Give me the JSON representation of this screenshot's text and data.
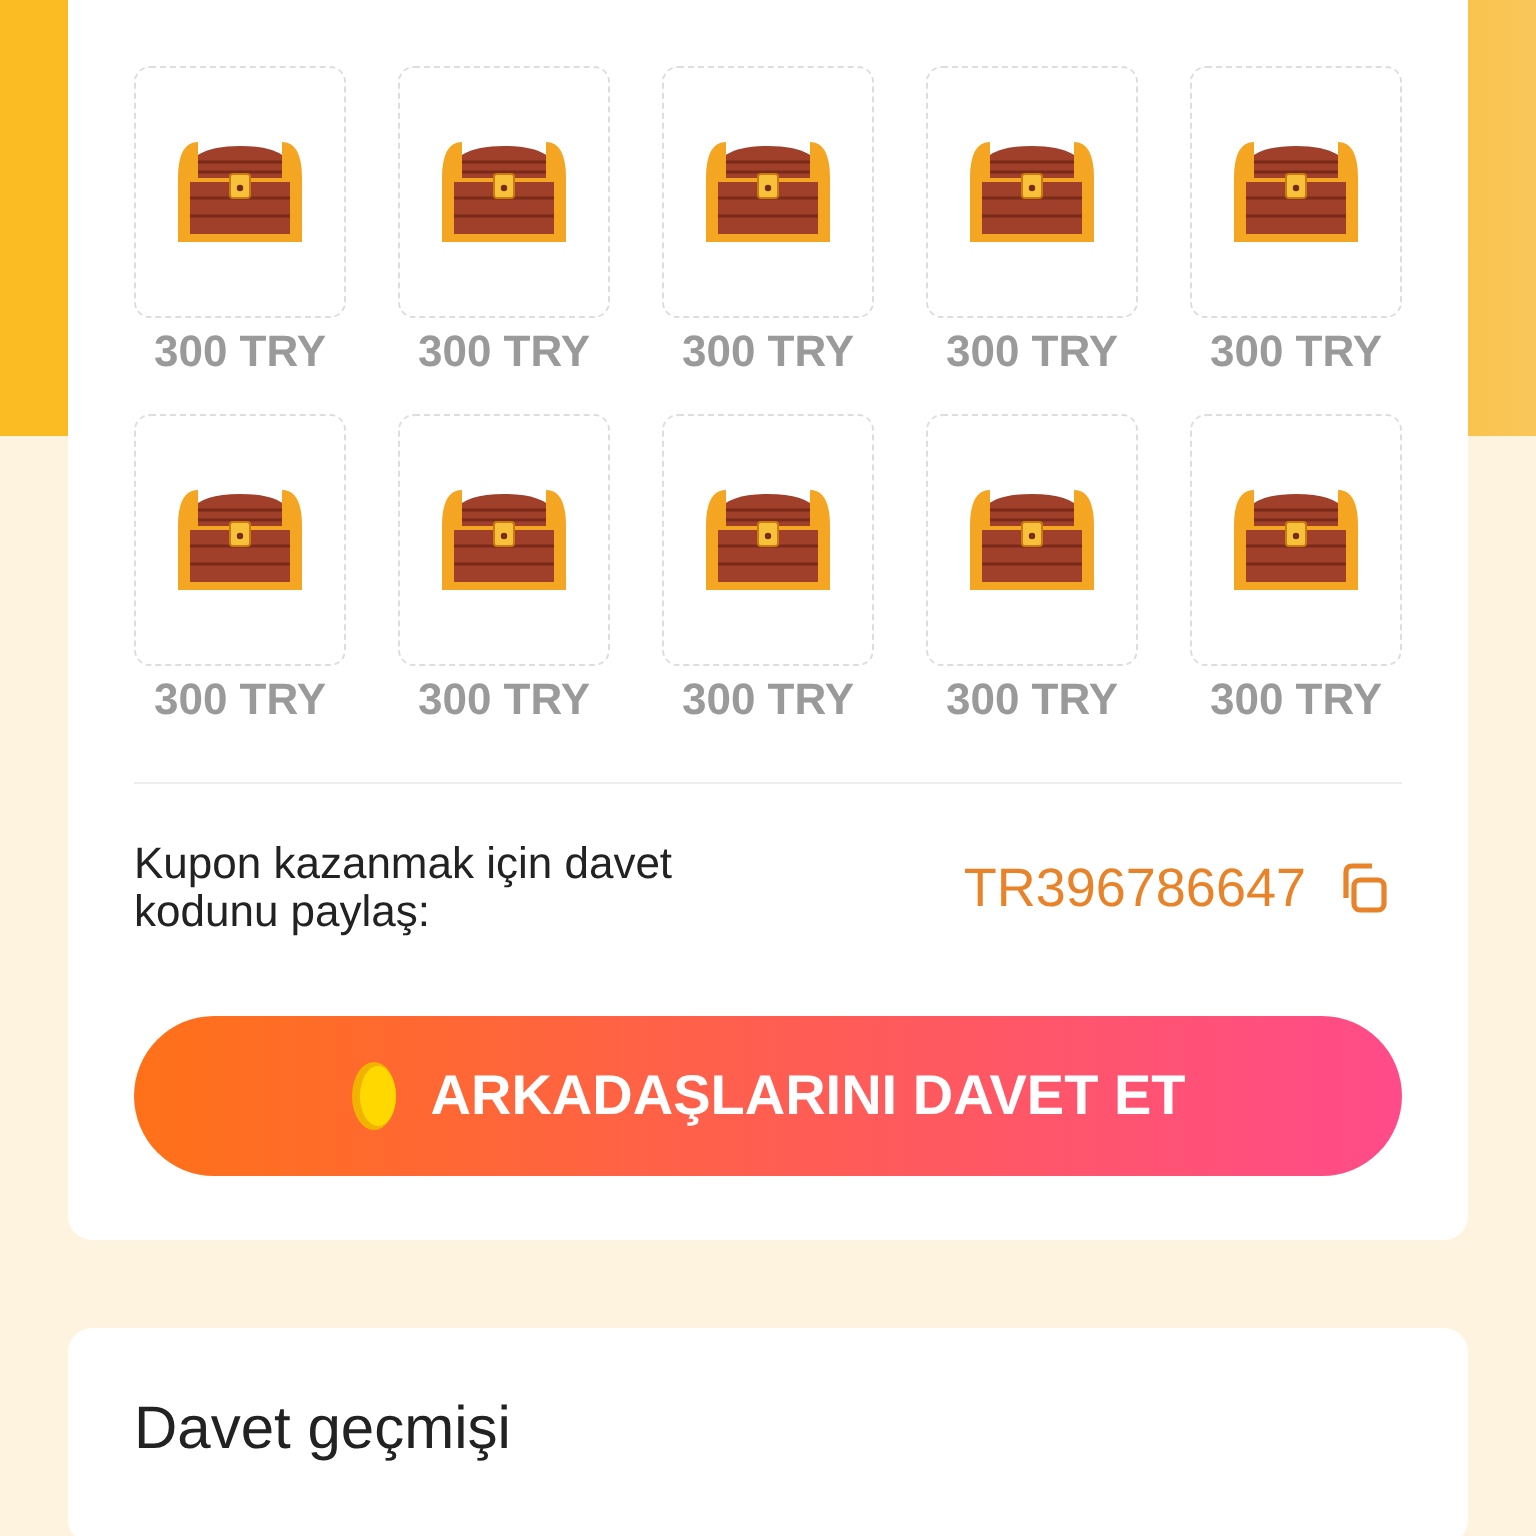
{
  "rewards": [
    {
      "amount": "300 TRY"
    },
    {
      "amount": "300 TRY"
    },
    {
      "amount": "300 TRY"
    },
    {
      "amount": "300 TRY"
    },
    {
      "amount": "300 TRY"
    },
    {
      "amount": "300 TRY"
    },
    {
      "amount": "300 TRY"
    },
    {
      "amount": "300 TRY"
    },
    {
      "amount": "300 TRY"
    },
    {
      "amount": "300 TRY"
    }
  ],
  "share": {
    "text": "Kupon kazanmak için davet kodunu paylaş:",
    "code": "TR396786647"
  },
  "invite_button": "ARKADAŞLARINI DAVET ET",
  "history": {
    "title": "Davet geçmişi"
  }
}
